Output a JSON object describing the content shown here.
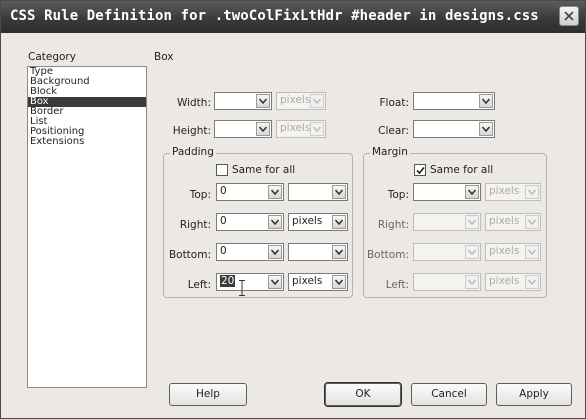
{
  "dialog": {
    "title": "CSS Rule Definition for .twoColFixLtHdr #header in designs.css"
  },
  "category": {
    "label": "Category",
    "items": [
      "Type",
      "Background",
      "Block",
      "Box",
      "Border",
      "List",
      "Positioning",
      "Extensions"
    ],
    "selected": "Box"
  },
  "panel": {
    "title": "Box"
  },
  "box": {
    "width_label": "Width:",
    "width_value": "",
    "width_unit": "pixels",
    "height_label": "Height:",
    "height_value": "",
    "height_unit": "pixels",
    "float_label": "Float:",
    "float_value": "",
    "clear_label": "Clear:",
    "clear_value": ""
  },
  "padding": {
    "title": "Padding",
    "same_for_all_label": "Same for all",
    "same_for_all_checked": false,
    "top_label": "Top:",
    "top_value": "0",
    "top_unit": "",
    "right_label": "Right:",
    "right_value": "0",
    "right_unit": "pixels",
    "bottom_label": "Bottom:",
    "bottom_value": "0",
    "bottom_unit": "",
    "left_label": "Left:",
    "left_value": "20",
    "left_unit": "pixels"
  },
  "margin": {
    "title": "Margin",
    "same_for_all_label": "Same for all",
    "same_for_all_checked": true,
    "top_label": "Top:",
    "top_value": "",
    "top_unit": "pixels",
    "right_label": "Right:",
    "right_value": "",
    "right_unit": "pixels",
    "bottom_label": "Bottom:",
    "bottom_value": "",
    "bottom_unit": "pixels",
    "left_label": "Left:",
    "left_value": "",
    "left_unit": "pixels"
  },
  "buttons": {
    "help": "Help",
    "ok": "OK",
    "cancel": "Cancel",
    "apply": "Apply"
  },
  "icons": {
    "close": "close-icon",
    "dropdown": "chevron-down-icon",
    "checkbox": "checkmark-icon",
    "cursor": "text-cursor-icon"
  }
}
